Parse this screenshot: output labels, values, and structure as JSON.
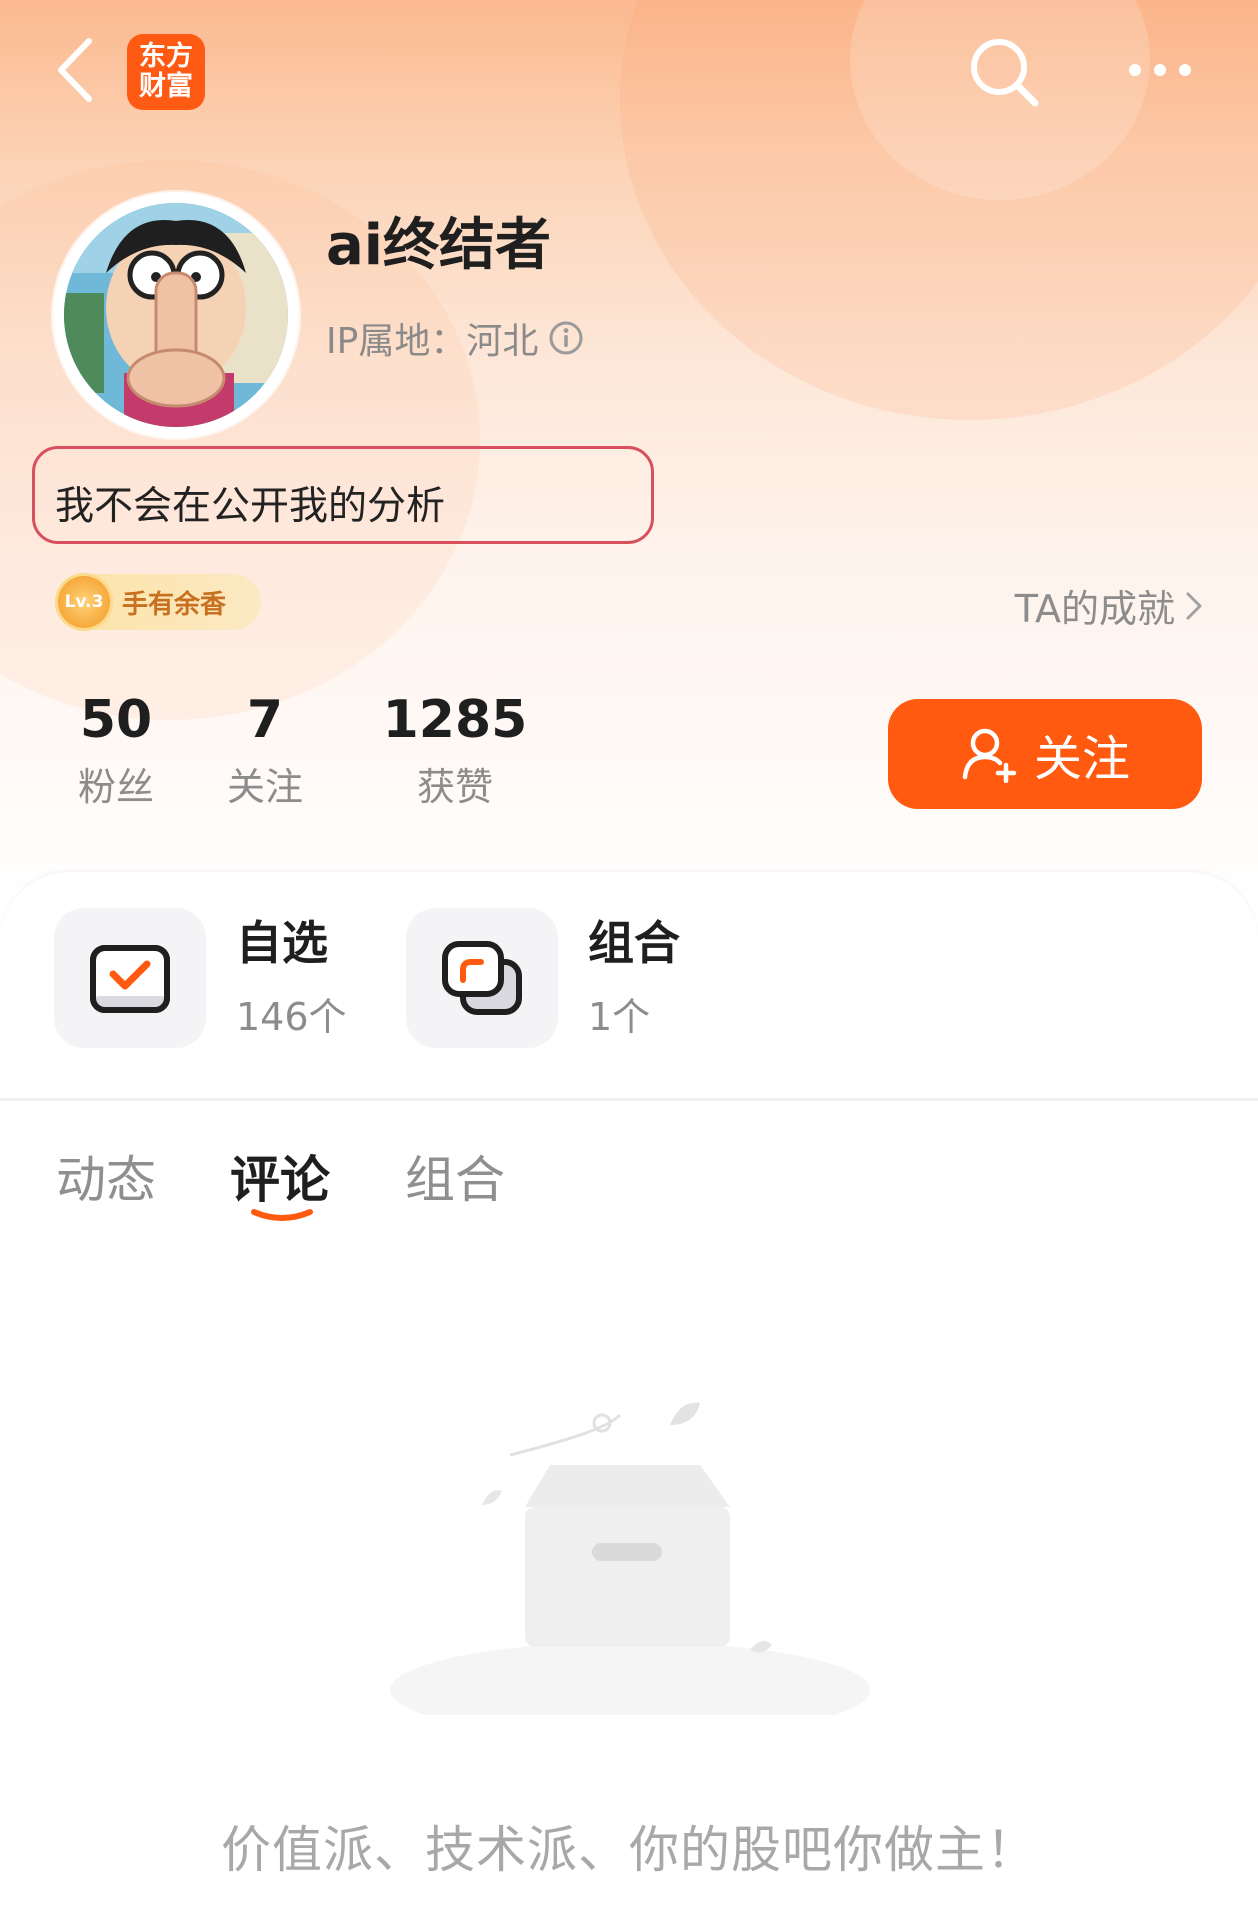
{
  "header": {
    "logo_line1": "东方",
    "logo_line2": "财富",
    "back_icon": "chevron-left-icon",
    "search_icon": "search-icon",
    "more_icon": "more-dots-icon"
  },
  "profile": {
    "username": "ai终结者",
    "ip_location": "IP属地：河北",
    "bio": "我不会在公开我的分析",
    "badge_level": "Lv.3",
    "badge_title": "手有余香",
    "achievements_link": "TA的成就"
  },
  "stats": [
    {
      "value": "50",
      "label": "粉丝"
    },
    {
      "value": "7",
      "label": "关注"
    },
    {
      "value": "1285",
      "label": "获赞"
    }
  ],
  "follow_button": {
    "label": "关注"
  },
  "features": [
    {
      "title": "自选",
      "count": "146个",
      "icon": "watchlist-check-icon"
    },
    {
      "title": "组合",
      "count": "1个",
      "icon": "portfolio-icon"
    }
  ],
  "tabs": [
    {
      "label": "动态",
      "active": false
    },
    {
      "label": "评论",
      "active": true
    },
    {
      "label": "组合",
      "active": false
    }
  ],
  "empty_state": {
    "illustration": "empty-box-icon",
    "message": "价值派、技术派、你的股吧你做主！"
  },
  "colors": {
    "accent": "#ff5a0f",
    "bio_border": "#d8505e",
    "hero_top": "#fbb98f"
  }
}
